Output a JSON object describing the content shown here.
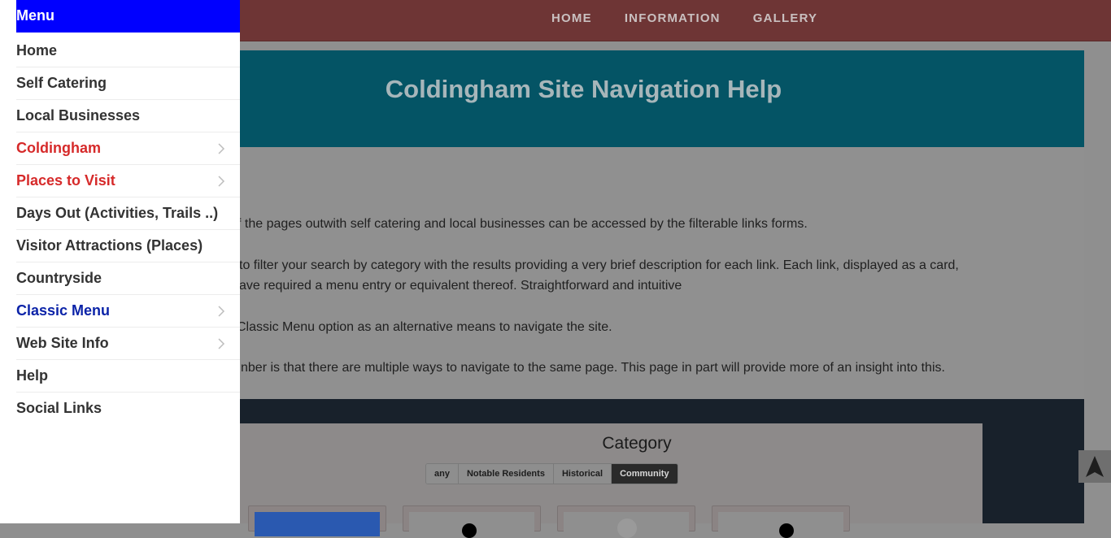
{
  "topnav": {
    "items": [
      "HOME",
      "INFORMATION",
      "GALLERY"
    ]
  },
  "hero": {
    "title": "Coldingham Site Navigation Help"
  },
  "content": {
    "paragraphs": [
      "f the pages outwith self catering and local businesses can be accessed by the filterable links forms.",
      "to filter your search by category with the results providing a very brief description for each link. Each link, displayed as a card,",
      "ave required a menu entry or equivalent thereof. Straightforward and intuitive",
      "Classic Menu option as an alternative means to navigate the site.",
      "nber is that there are multiple ways to navigate to the same page. This page in part will provide more of an insight into this."
    ]
  },
  "category": {
    "title": "Category",
    "filters": [
      "any",
      "Notable Residents",
      "Historical",
      "Community"
    ],
    "active_filter": "Community"
  },
  "drawer": {
    "title": "Menu",
    "items": [
      {
        "label": "Home",
        "color": "dark",
        "submenu": false
      },
      {
        "label": "Self Catering",
        "color": "dark",
        "submenu": false
      },
      {
        "label": "Local Businesses",
        "color": "dark",
        "submenu": false
      },
      {
        "label": "Coldingham",
        "color": "red",
        "submenu": true
      },
      {
        "label": "Places to Visit",
        "color": "red",
        "submenu": true
      },
      {
        "label": "Days Out (Activities, Trails ..)",
        "color": "dark",
        "submenu": false
      },
      {
        "label": "Visitor Attractions (Places)",
        "color": "dark",
        "submenu": false
      },
      {
        "label": "Countryside",
        "color": "dark",
        "submenu": false
      },
      {
        "label": "Classic Menu",
        "color": "blue",
        "submenu": true
      },
      {
        "label": "Web Site Info",
        "color": "dark",
        "submenu": true
      },
      {
        "label": "Help",
        "color": "dark",
        "submenu": false
      },
      {
        "label": "Social Links",
        "color": "dark",
        "submenu": false
      }
    ]
  },
  "colors": {
    "drawer_header": "#0000ff",
    "menu_red": "#d62a2a",
    "menu_blue": "#0b23a8",
    "hero_bg": "#045465",
    "topbar_bg": "#6e3535"
  },
  "icons": {
    "submenu": "chevron-right-icon",
    "scroll_top": "navigation-arrow-icon"
  }
}
